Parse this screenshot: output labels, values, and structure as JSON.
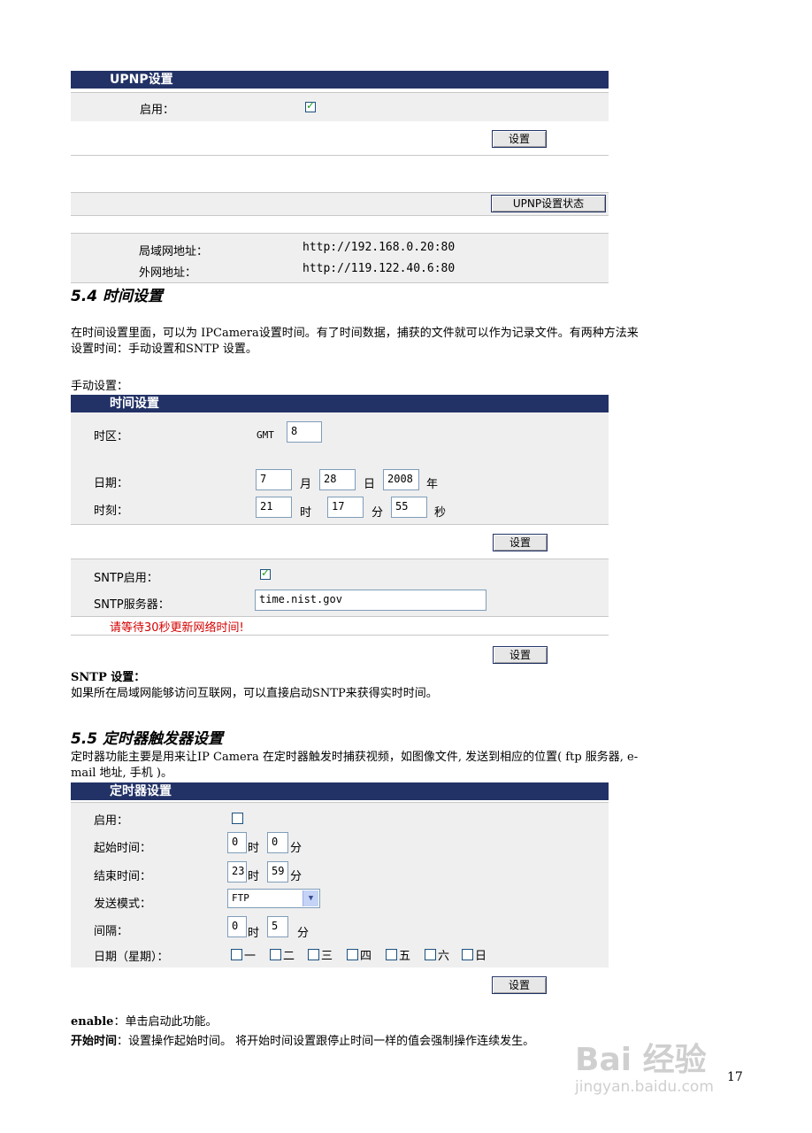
{
  "upnp": {
    "title": "UPNP设置",
    "enable_label": "启用：",
    "set_button": "设置",
    "status_button": "UPNP设置状态",
    "lan_label": "局域网地址：",
    "lan_value": "http://192.168.0.20:80",
    "wan_label": "外网地址：",
    "wan_value": "http://119.122.40.6:80"
  },
  "sec54": {
    "heading": "5.4  时间设置",
    "para_line1": "在时间设置里面，可以为  IPCamera设置时间。有了时间数据，捕获的文件就可以作为记录文件。有两种方法来",
    "para_line2": "设置时间：手动设置和SNTP  设置。",
    "manual_label": "手动设置："
  },
  "time_panel": {
    "title": "时间设置",
    "timezone_label": "时区：",
    "gmt": "GMT",
    "gmt_value": "8",
    "date_label": "日期：",
    "month_value": "7",
    "month_unit": "月",
    "day_value": "28",
    "day_unit": "日",
    "year_value": "2008",
    "year_unit": "年",
    "clock_label": "时刻：",
    "hour_value": "21",
    "hour_unit": "时",
    "minute_value": "17",
    "minute_unit": "分",
    "second_value": "55",
    "second_unit": "秒",
    "set_button": "设置",
    "sntp_enable_label": "SNTP启用：",
    "sntp_server_label": "SNTP服务器：",
    "sntp_server_value": "time.nist.gov",
    "wait_msg": "请等待30秒更新网络时间!",
    "set_button2": "设置"
  },
  "sntp_desc": {
    "title": "SNTP  设置：",
    "text": "如果所在局域网能够访问互联网，可以直接启动SNTP来获得实时时间。"
  },
  "sec55": {
    "heading": "5.5  定时器触发器设置",
    "para_line1": "定时器功能主要是用来让IP  Camera  在定时器触发时捕获视频，如图像文件, 发送到相应的位置(  ftp  服务器,  e-",
    "para_line2": "mail  地址,  手机  )。"
  },
  "timer_panel": {
    "title": "定时器设置",
    "enable_label": "启用：",
    "start_label": "起始时间：",
    "start_hour": "0",
    "start_min": "0",
    "hour_unit": "时",
    "min_unit": "分",
    "end_label": "结束时间：",
    "end_hour": "23",
    "end_min": "59",
    "mode_label": "发送模式：",
    "mode_value": "FTP",
    "interval_label": "间隔：",
    "interval_hour": "0",
    "interval_min": "5",
    "week_label": "日期（星期）：",
    "days": [
      "一",
      "二",
      "三",
      "四",
      "五",
      "六",
      "日"
    ],
    "set_button": "设置"
  },
  "notes": {
    "enable_term": "enable",
    "enable_text": "：单击启动此功能。",
    "start_term": "开始时间",
    "start_text": "：设置操作起始时间。  将开始时间设置跟停止时间一样的值会强制操作连续发生。"
  },
  "page_number": "17",
  "watermark": {
    "logo": "Bai 经验",
    "url": "jingyan.baidu.com"
  }
}
